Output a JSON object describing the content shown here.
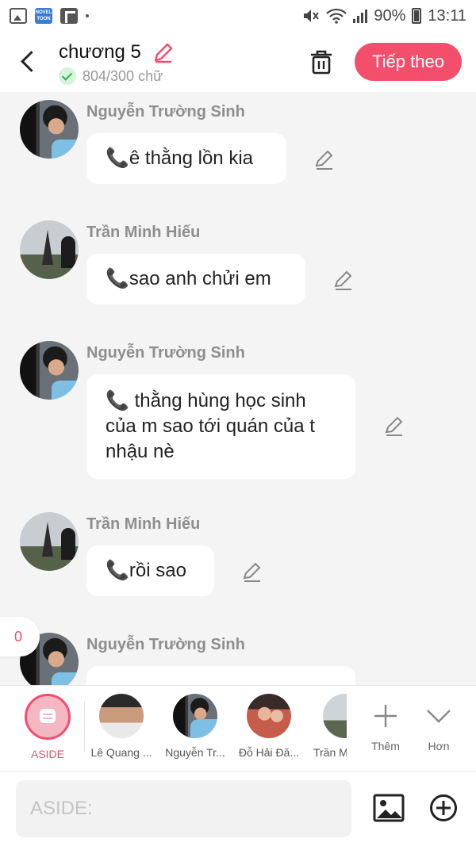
{
  "status_bar": {
    "battery": "90%",
    "time": "13:11",
    "novel_badge": "NOVEL TOON"
  },
  "header": {
    "title": "chương 5",
    "word_count": "804/300 chữ",
    "next_button": "Tiếp theo"
  },
  "messages": [
    {
      "sender": "Nguyễn Trường Sinh",
      "text": "📞ê thằng lồn kia"
    },
    {
      "sender": "Trần Minh Hiếu",
      "text": "📞sao anh chửi em"
    },
    {
      "sender": "Nguyễn Trường Sinh",
      "text": "📞 thằng hùng học sinh của m sao tới quán của t nhậu nè"
    },
    {
      "sender": "Trần Minh Hiếu",
      "text": "📞rồi sao"
    },
    {
      "sender": "Nguyễn Trường Sinh",
      "text": ""
    }
  ],
  "unread_count": "0",
  "characters": [
    {
      "label": "ASIDE"
    },
    {
      "label": "Lê Quang ..."
    },
    {
      "label": "Nguyễn Tr..."
    },
    {
      "label": "Đỗ Hải Đă..."
    },
    {
      "label": "Trần M"
    }
  ],
  "actions": {
    "more": "Thêm",
    "less": "Hơn"
  },
  "composer": {
    "placeholder": "ASIDE:"
  },
  "colors": {
    "accent": "#f44e6d",
    "background": "#f4f4f4",
    "bubble": "#ffffff",
    "success": "#2eb24b"
  },
  "icons": {
    "back": "chevron-left-icon",
    "edit_title": "pencil-icon",
    "delete": "trash-icon",
    "edit_message": "pencil-icon",
    "add_character": "plus-icon",
    "collapse": "chevron-down-icon",
    "insert_image": "image-icon",
    "more_options": "plus-circle-icon"
  }
}
